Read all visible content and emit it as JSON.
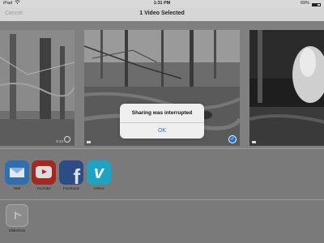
{
  "status_bar": {
    "carrier": "iPad",
    "time": "1:31 PM",
    "battery": "69%",
    "battery_level": 0.69
  },
  "nav": {
    "cancel_label": "Cancel",
    "title": "1 Video Selected"
  },
  "photos": [
    {
      "badge": "0:14",
      "selected": false
    },
    {
      "badge": "",
      "selected": true
    },
    {
      "badge": "",
      "selected": false
    }
  ],
  "share_apps": [
    {
      "label": "Mail",
      "icon": "mail-icon"
    },
    {
      "label": "YouTube",
      "icon": "youtube-icon"
    },
    {
      "label": "Facebook",
      "icon": "facebook-icon"
    },
    {
      "label": "Vimeo",
      "icon": "vimeo-icon"
    }
  ],
  "actions": [
    {
      "label": "Slideshow",
      "icon": "slideshow-icon"
    }
  ],
  "alert": {
    "title": "Sharing was interrupted",
    "ok_label": "OK"
  },
  "colors": {
    "accent": "#1a73e8",
    "selection": "#1e6fd9"
  }
}
